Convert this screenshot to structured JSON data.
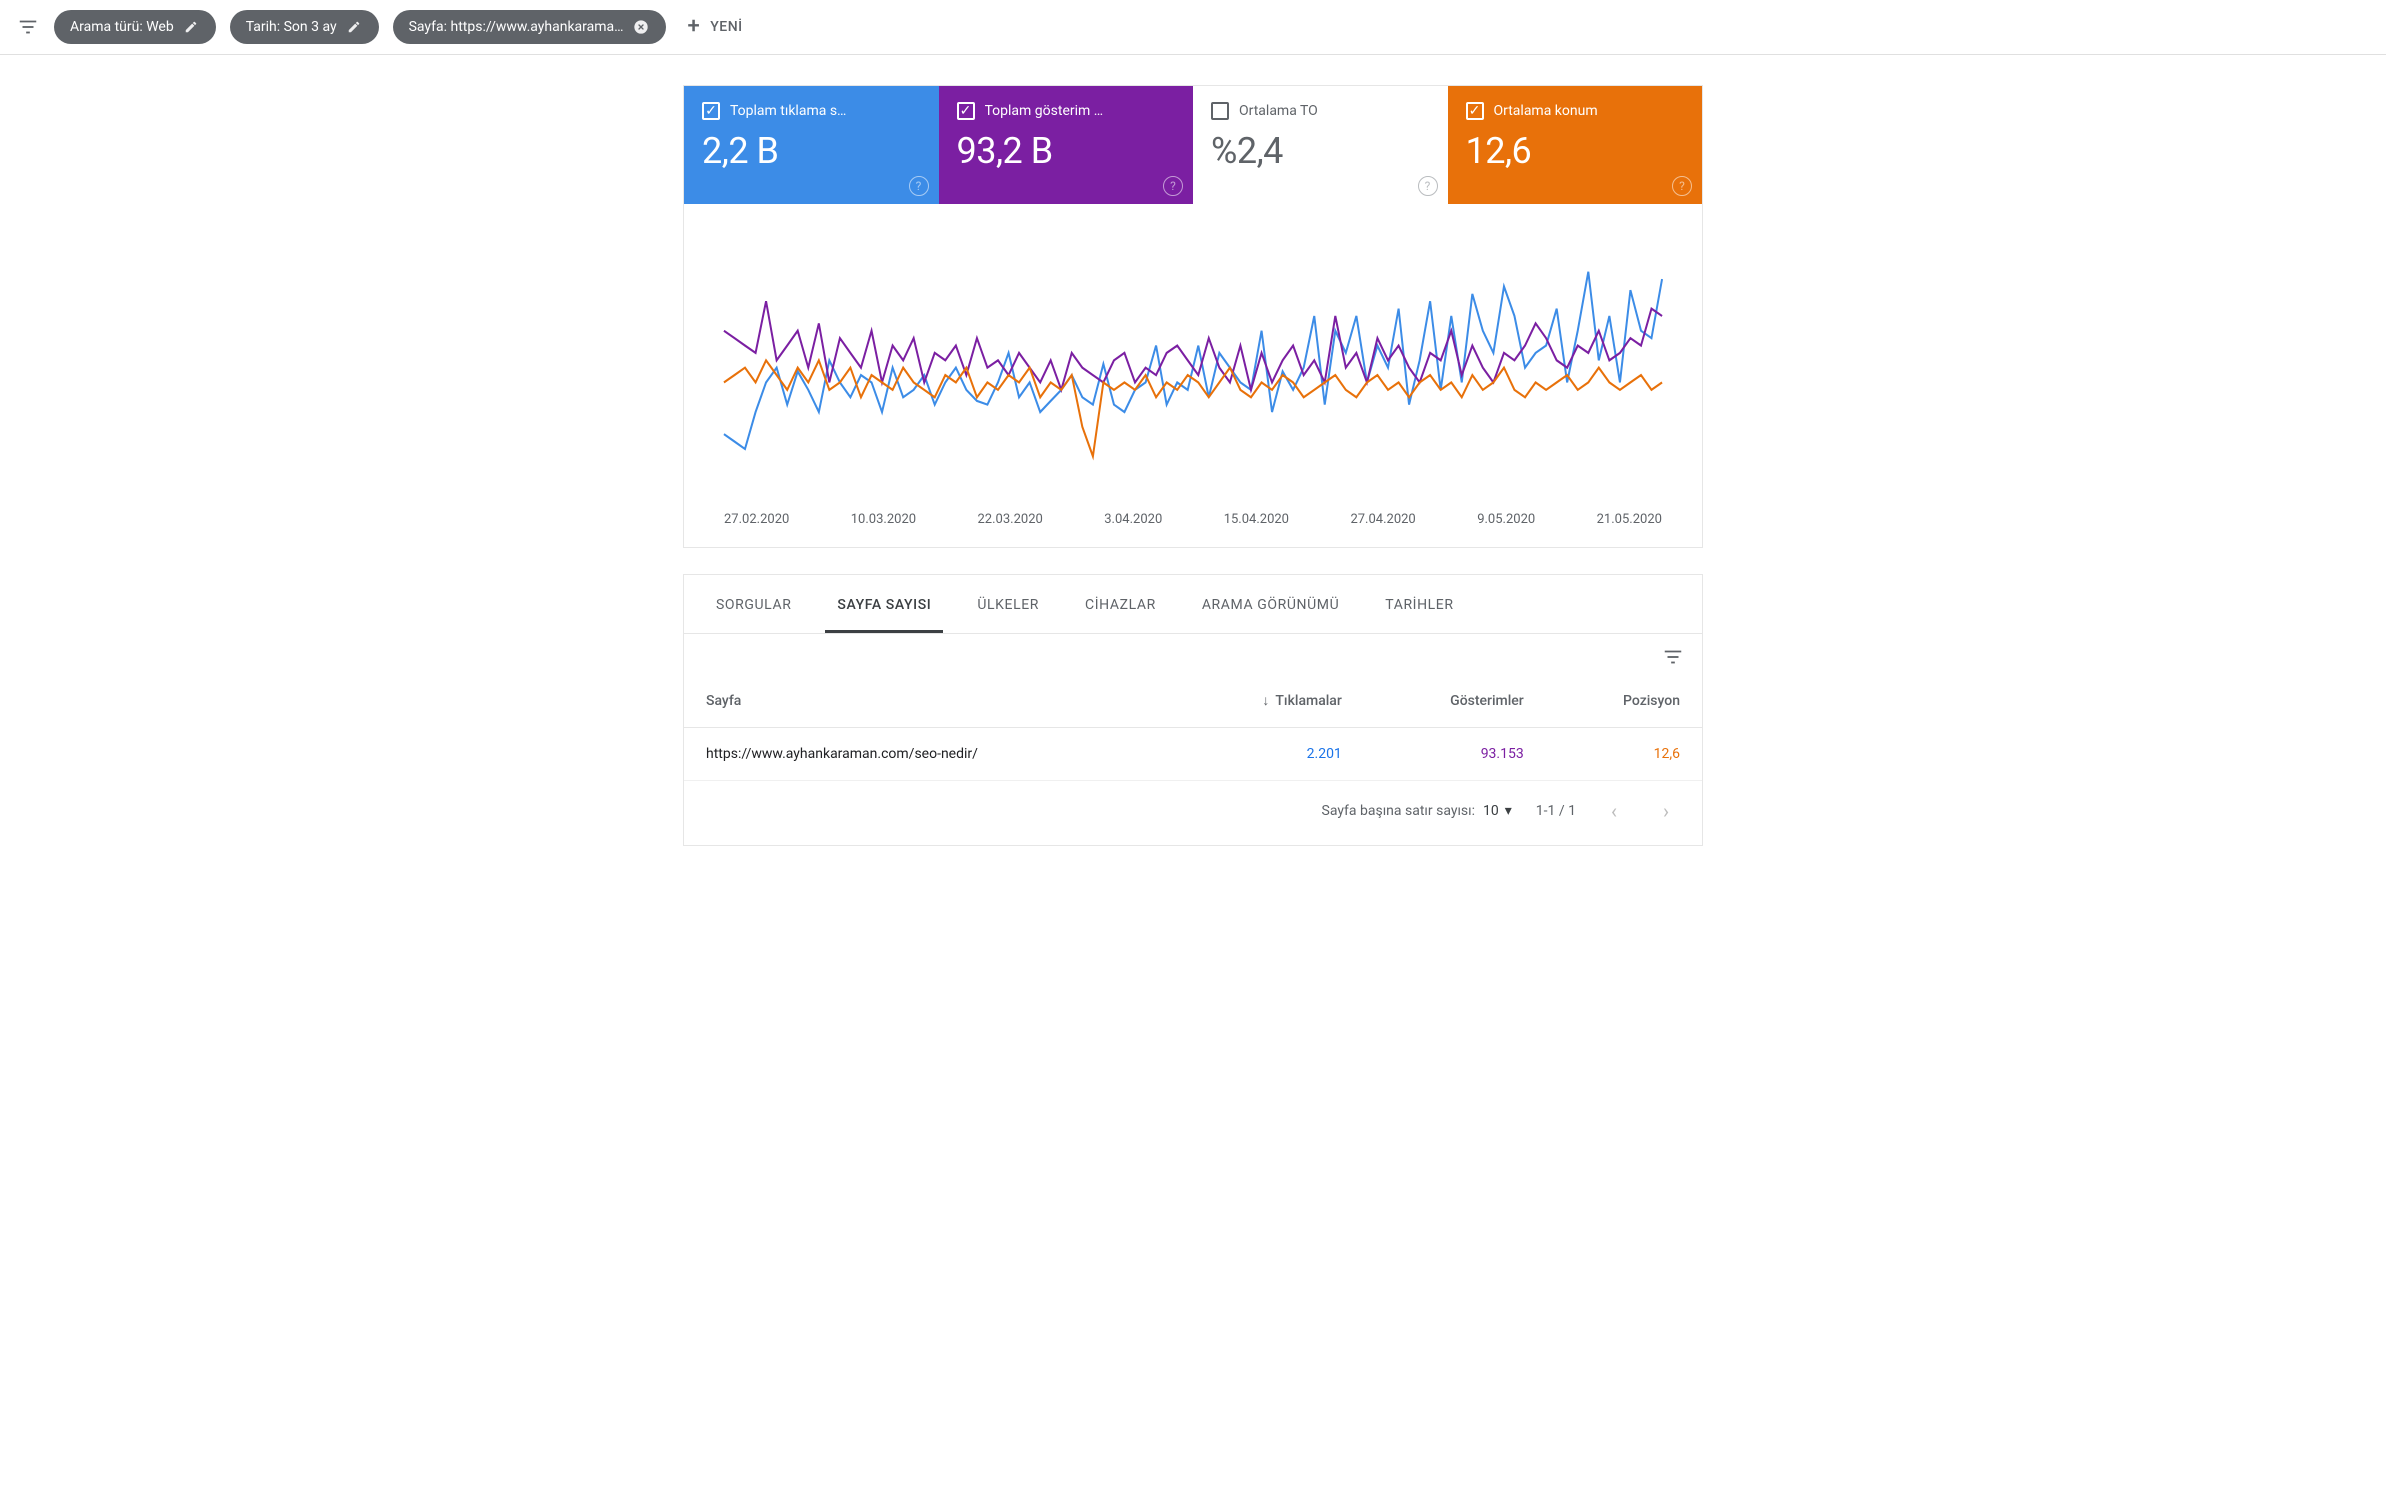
{
  "filters": {
    "chips": [
      {
        "label": "Arama türü: Web",
        "action": "edit"
      },
      {
        "label": "Tarih: Son 3 ay",
        "action": "edit"
      },
      {
        "label": "Sayfa: https://www.ayhankarama…",
        "action": "close"
      }
    ],
    "new_label": "YENİ"
  },
  "cards": [
    {
      "label": "Toplam tıklama s…",
      "value": "2,2 B",
      "checked": true,
      "bg": "#3c8ce7",
      "fg": "#ffffff"
    },
    {
      "label": "Toplam gösterim …",
      "value": "93,2 B",
      "checked": true,
      "bg": "#7b1fa2",
      "fg": "#ffffff"
    },
    {
      "label": "Ortalama TO",
      "value": "%2,4",
      "checked": false,
      "bg": "#ffffff",
      "fg": "#5f6368"
    },
    {
      "label": "Ortalama konum",
      "value": "12,6",
      "checked": true,
      "bg": "#e8710a",
      "fg": "#ffffff"
    }
  ],
  "chart_data": {
    "type": "line",
    "x_ticks": [
      "27.02.2020",
      "10.03.2020",
      "22.03.2020",
      "3.04.2020",
      "15.04.2020",
      "27.04.2020",
      "9.05.2020",
      "21.05.2020"
    ],
    "series": [
      {
        "name": "Tıklamalar",
        "color": "#3c8ce7",
        "values": [
          16,
          14,
          12,
          22,
          30,
          34,
          24,
          33,
          28,
          22,
          36,
          30,
          26,
          32,
          30,
          22,
          34,
          26,
          28,
          32,
          24,
          30,
          34,
          28,
          25,
          24,
          30,
          38,
          26,
          30,
          22,
          25,
          28,
          32,
          26,
          24,
          35,
          24,
          22,
          28,
          30,
          40,
          24,
          30,
          28,
          40,
          26,
          38,
          34,
          30,
          28,
          44,
          22,
          33,
          28,
          34,
          48,
          24,
          44,
          38,
          48,
          30,
          40,
          34,
          50,
          24,
          36,
          52,
          28,
          48,
          30,
          54,
          44,
          38,
          56,
          48,
          34,
          38,
          40,
          50,
          30,
          44,
          60,
          36,
          48,
          30,
          55,
          44,
          42,
          58
        ]
      },
      {
        "name": "Gösterimler",
        "color": "#7b1fa2",
        "values": [
          44,
          42,
          40,
          38,
          52,
          36,
          40,
          44,
          34,
          46,
          30,
          42,
          38,
          34,
          44,
          30,
          40,
          36,
          42,
          30,
          38,
          36,
          40,
          32,
          42,
          34,
          36,
          32,
          38,
          34,
          30,
          36,
          28,
          38,
          34,
          32,
          30,
          36,
          38,
          30,
          34,
          32,
          38,
          40,
          36,
          32,
          42,
          34,
          30,
          40,
          28,
          38,
          30,
          36,
          40,
          32,
          36,
          30,
          48,
          34,
          38,
          30,
          42,
          36,
          40,
          34,
          30,
          38,
          36,
          44,
          32,
          40,
          34,
          30,
          38,
          36,
          40,
          46,
          42,
          36,
          34,
          40,
          38,
          44,
          36,
          38,
          42,
          40,
          50,
          48
        ]
      },
      {
        "name": "Ortalama konum",
        "color": "#e8710a",
        "values": [
          30,
          32,
          34,
          30,
          36,
          32,
          28,
          34,
          30,
          36,
          28,
          30,
          34,
          26,
          32,
          30,
          28,
          34,
          30,
          28,
          26,
          32,
          30,
          34,
          26,
          30,
          28,
          32,
          30,
          34,
          26,
          30,
          28,
          32,
          18,
          10,
          30,
          28,
          30,
          28,
          32,
          26,
          30,
          28,
          32,
          30,
          26,
          30,
          34,
          28,
          26,
          30,
          28,
          32,
          30,
          26,
          28,
          30,
          32,
          28,
          26,
          30,
          32,
          28,
          30,
          26,
          30,
          32,
          28,
          30,
          26,
          32,
          28,
          30,
          34,
          28,
          26,
          30,
          28,
          30,
          32,
          28,
          30,
          34,
          30,
          28,
          30,
          32,
          28,
          30
        ]
      }
    ],
    "ylim": [
      0,
      70
    ]
  },
  "tabs": {
    "items": [
      "SORGULAR",
      "SAYFA SAYISI",
      "ÜLKELER",
      "CİHAZLAR",
      "ARAMA GÖRÜNÜMÜ",
      "TARİHLER"
    ],
    "active_index": 1
  },
  "table": {
    "columns": {
      "page": "Sayfa",
      "clicks": "Tıklamalar",
      "impressions": "Gösterimler",
      "position": "Pozisyon"
    },
    "sort_column": "clicks",
    "sort_dir": "desc",
    "rows": [
      {
        "page": "https://www.ayhankaraman.com/seo-nedir/",
        "clicks": "2.201",
        "impressions": "93.153",
        "position": "12,6"
      }
    ]
  },
  "pagination": {
    "label": "Sayfa başına satır sayısı:",
    "page_size": "10",
    "range": "1-1 / 1"
  }
}
